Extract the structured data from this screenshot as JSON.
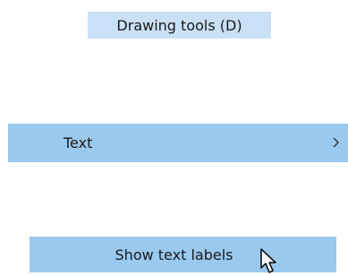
{
  "tooltip": {
    "text": "Drawing tools (D)"
  },
  "menu": {
    "item_label": "Text",
    "submenu_icon": "chevron-right-icon"
  },
  "button": {
    "label": "Show text labels"
  },
  "cursor": {
    "icon": "mouse-pointer-icon"
  },
  "colors": {
    "tooltip_bg": "#c9e0f7",
    "highlight_bg": "#99c9ef",
    "text": "#1a1a1a"
  }
}
